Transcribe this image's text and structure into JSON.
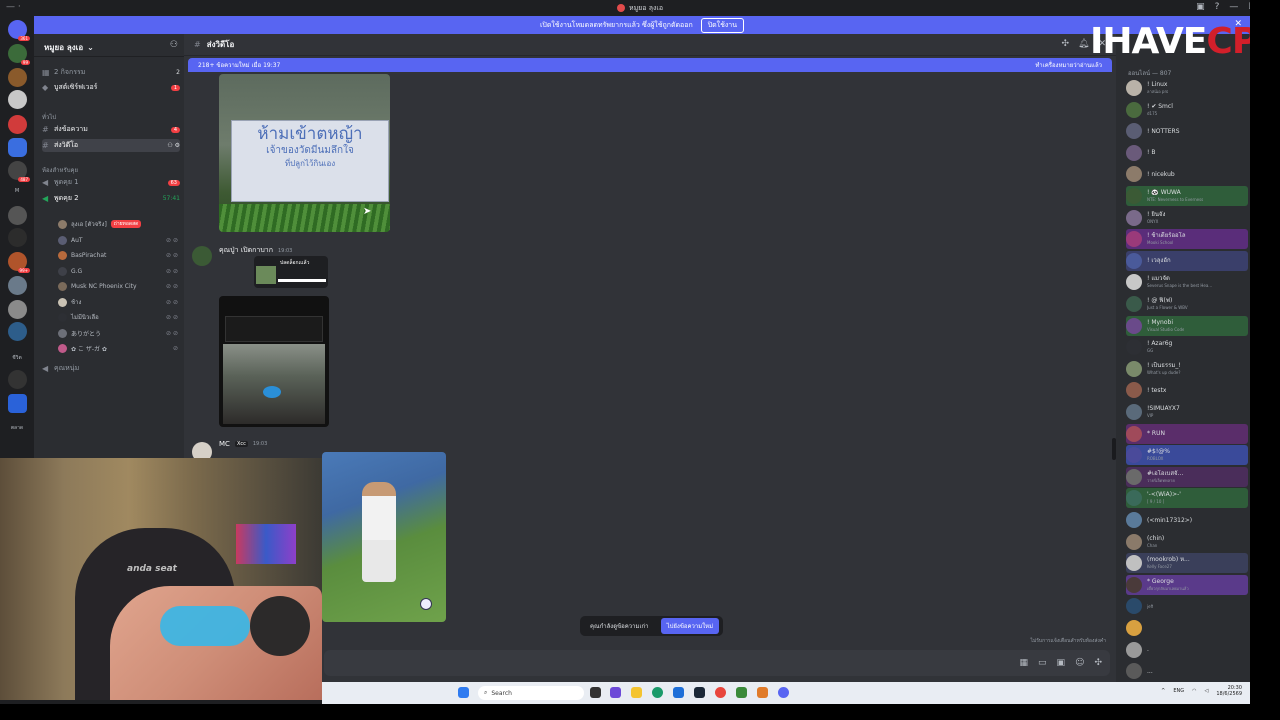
{
  "window": {
    "title": "หมูยอ ลุงเอ",
    "left_hint": "— ·"
  },
  "notice": {
    "text": "เปิดใช้งานโหมดลดทรัพยากรแล้ว ซึ่งผู้ใช้ถูกตัดออก",
    "button": "ปิดใช้งาน"
  },
  "server_rail": {
    "badges": [
      "361",
      "99",
      "487",
      "99+"
    ],
    "labels": [
      "M",
      "ชีวิต",
      "ตลาด"
    ]
  },
  "sidebar": {
    "server_name": "หมูยอ ลุงเอ",
    "chevron": "⌄",
    "top_rows": [
      {
        "label": "2 กิจกรรม",
        "count": "2"
      },
      {
        "label": "บูสต์เซิร์ฟเวอร์",
        "count": "1"
      }
    ],
    "cat_main": "ทั่วไป",
    "text_channels": [
      {
        "label": "ส่งข้อความ",
        "count": "4"
      },
      {
        "label": "ส่งวิดีโอ",
        "selected": true
      }
    ],
    "cat_voice": "ห้องสำหรับคุย",
    "voice_channels": [
      {
        "label": "พูดคุย 1",
        "count": "63"
      },
      {
        "label": "พูดคุย 2",
        "time": "57:41"
      }
    ],
    "users": [
      {
        "name": "ลุงเอ [ตัวจริง]",
        "live": "ถ่ายทอดสด"
      },
      {
        "name": "AuT",
        "tail": ""
      },
      {
        "name": "BasPirachat",
        "tail": "🎮"
      },
      {
        "name": "G.G",
        "tail": ""
      },
      {
        "name": "Musk NC Phoenix City",
        "tail": ""
      },
      {
        "name": "ช้าง",
        "tail": "MEOW"
      },
      {
        "name": "ไม่มีนิวเลือ",
        "tail": ""
      },
      {
        "name": "ありがとう",
        "tail": ""
      },
      {
        "name": "✿ こ ザ-ガ ✿",
        "tail": "cute"
      }
    ],
    "extra_channel": "คุณหนุ่ม"
  },
  "chat": {
    "channel_name": "ส่งวิดีโอ",
    "new_bar_left": "218+ ข้อความใหม่ เมื่อ 19:37",
    "new_bar_right": "ทำเครื่องหมายว่าอ่านแล้ว",
    "sign_line1": "ห้ามเข้าตหญ้า",
    "sign_line2": "เจ้าของวัดมีนมลึกใจ",
    "sign_line3": "ที่ปลูกไว้กินเอง",
    "msg2_author": "คุณปู่า เปิดกาบาก",
    "msg2_time": "19:03",
    "msg2_spoiler": "ปลดล็อกเแล้ว",
    "msg3_author": "MC",
    "msg3_tag": "Xcc",
    "msg3_time": "19:03",
    "pill_old": "คุณกำลังดูข้อความเก่า",
    "pill_new": "ไปยังข้อความใหม่",
    "footer_note": "ไม่รับการแจ้งเตือนสำหรับห้องส่งคำ"
  },
  "members": {
    "header": "ออนไลน์ — 807",
    "list": [
      {
        "name": "! Linux",
        "sub": "ลาสน์เอ pro"
      },
      {
        "name": "! ✔ Smcl",
        "sub": "d175"
      },
      {
        "name": "! NOTTERS",
        "sub": ""
      },
      {
        "name": "! B",
        "sub": ""
      },
      {
        "name": "! nicekub",
        "sub": ""
      },
      {
        "name": "! 🐼 WUWA",
        "sub": "NTE: Neverness to Everness"
      },
      {
        "name": "! ยินจัง",
        "sub": "ONYX"
      },
      {
        "name": "! ช้าเดียร์ออโล",
        "sub": "Mooki School"
      },
      {
        "name": "! เวลุงอัก",
        "sub": ""
      },
      {
        "name": "! แมวจัด",
        "sub": "Severus Snape is the best Hea..."
      },
      {
        "name": "! @ ฟิ(ฟ)",
        "sub": "Just a Flower & WBV"
      },
      {
        "name": "! Mynobi",
        "sub": "Visual Studio Code"
      },
      {
        "name": "! Azar6g",
        "sub": "GG"
      },
      {
        "name": "! เป็นธรรม_!",
        "sub": "What's up dude?"
      },
      {
        "name": "! testx",
        "sub": ""
      },
      {
        "name": "!SIMUAYX7",
        "sub": "VIP"
      },
      {
        "name": "* RUN",
        "sub": ""
      },
      {
        "name": "#$!@%",
        "sub": "ROBLOX"
      },
      {
        "name": "#เอโอเบสจั...",
        "sub": "วายร์เล็ดทหลาย"
      },
      {
        "name": "'-<(WiA)>-'",
        "sub": "[ 9 / 10 ]"
      },
      {
        "name": "(<min17312>)",
        "sub": ""
      },
      {
        "name": "(chin)",
        "sub": "Chan"
      },
      {
        "name": "(mookrob) ห...",
        "sub": "Kelly Face27"
      },
      {
        "name": "* George",
        "sub": "เดี๋ยวกุกลับมาเลยมาแล้ว"
      },
      {
        "name": "",
        "sub": "jeff"
      },
      {
        "name": "",
        "sub": ""
      },
      {
        "name": ".",
        "sub": ""
      },
      {
        "name": "...",
        "sub": ""
      }
    ]
  },
  "overlay_logo": {
    "white": "IHAVE",
    "red": "CPU"
  },
  "webcam": {
    "chair_text": "anda seat"
  },
  "taskbar": {
    "search": "Search",
    "lang": "ENG",
    "time": "20:30",
    "date": "18/6/2569"
  },
  "colors": {
    "blurple": "#5865f2",
    "bg": "#313338",
    "sidebar": "#2b2d31",
    "red": "#d21f2a"
  }
}
